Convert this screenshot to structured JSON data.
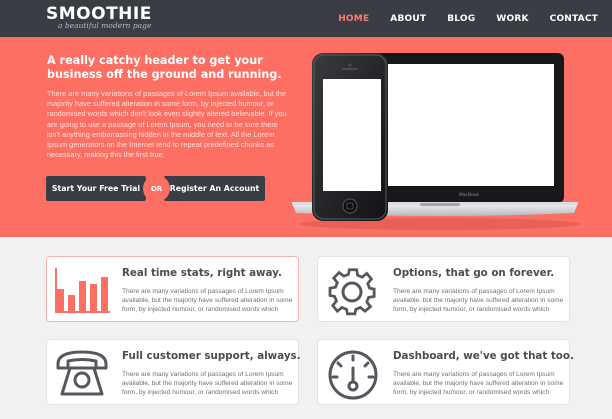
{
  "brand": {
    "logo": "SMOOTHIE",
    "tagline": "a beautiful modern page"
  },
  "nav": {
    "items": [
      {
        "label": "HOME",
        "active": true
      },
      {
        "label": "ABOUT",
        "active": false
      },
      {
        "label": "BLOG",
        "active": false
      },
      {
        "label": "WORK",
        "active": false
      },
      {
        "label": "CONTACT",
        "active": false
      }
    ]
  },
  "hero": {
    "title": "A really catchy header to get your business off the ground and running.",
    "body": "There are many variations of passages of Lorem Ipsum available, but the majority have suffered alteration in some form, by injected humour, or randomised words which don't look even slightly altered believable. If you are going to use a passage of Lorem Ipsum, you need to be sure there isn't anything embarrassing hidden in the middle of text. All the Lorem Ipsum generators on the Internet tend to repeat predefined chunks as necessary, making this the first true.",
    "cta_primary": "Start Your Free Trial",
    "cta_or": "OR",
    "cta_secondary": "Register An Account",
    "laptop_label": "MacBook"
  },
  "features": [
    {
      "title": "Real time stats, right away.",
      "body": "There are many variations of passages of Lorem Ipsum available, but the majority have suffered alteration in some form, by injected humour, or randomised words which",
      "icon": "bar-chart-icon"
    },
    {
      "title": "Options, that go on forever.",
      "body": "There are many variations of passages of Lorem Ipsum available, but the majority have suffered alteration in some form, by injected humour, or randomised words which",
      "icon": "gear-icon"
    },
    {
      "title": "Full customer support, always.",
      "body": "There are many variations of passages of Lorem Ipsum available, but the majority have suffered alteration in some form, by injected humour, or randomised words which",
      "icon": "phone-icon"
    },
    {
      "title": "Dashboard, we've got that too.",
      "body": "There are many variations of passages of Lorem Ipsum available, but the majority have suffered alteration in some form, by injected humour, or randomised words which",
      "icon": "dashboard-icon"
    }
  ],
  "colors": {
    "accent": "#fd6e63",
    "dark": "#3b3d44",
    "icon_gray": "#55575e"
  }
}
